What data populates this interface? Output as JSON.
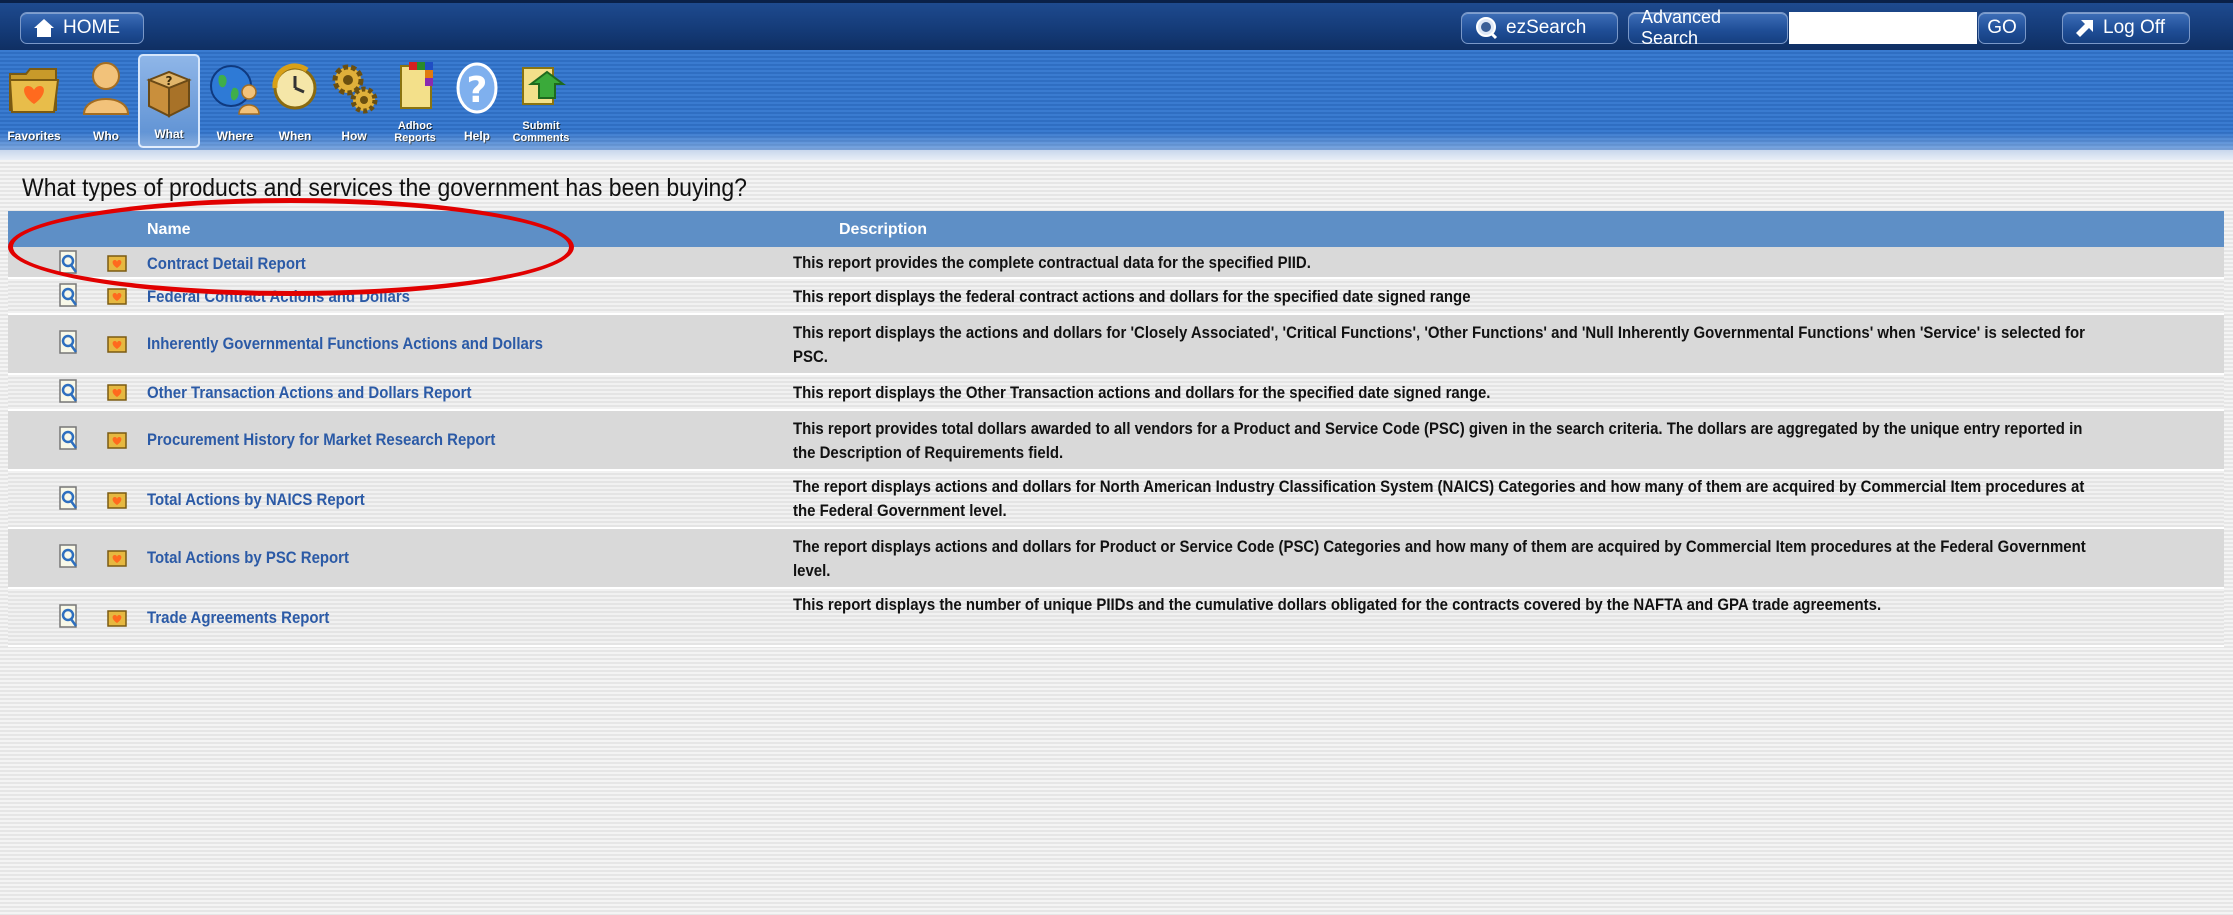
{
  "topbar": {
    "home_label": "HOME",
    "ezsearch_label": "ezSearch",
    "advanced_search_label": "Advanced Search",
    "search_value": "",
    "go_label": "GO",
    "logoff_label": "Log Off"
  },
  "toolbar": {
    "items": [
      {
        "label": "Favorites",
        "icon": "favorites-folder-icon"
      },
      {
        "label": "Who",
        "icon": "person-icon"
      },
      {
        "label": "What",
        "icon": "open-box-icon",
        "active": true
      },
      {
        "label": "Where",
        "icon": "globe-person-icon"
      },
      {
        "label": "When",
        "icon": "clock-icon"
      },
      {
        "label": "How",
        "icon": "gears-icon"
      },
      {
        "label": "Adhoc Reports",
        "icon": "adhoc-reports-icon"
      },
      {
        "label": "Help",
        "icon": "help-question-icon"
      },
      {
        "label": "Submit Comments",
        "icon": "submit-comments-icon"
      }
    ]
  },
  "page": {
    "title": "What types of products and services the government has been buying?"
  },
  "table": {
    "headers": {
      "name": "Name",
      "description": "Description"
    },
    "rows": [
      {
        "name": "Contract Detail Report",
        "description": "This report provides the complete contractual data for the specified PIID."
      },
      {
        "name": "Federal Contract Actions and Dollars",
        "description": "This report displays the federal contract actions and dollars for the specified date signed range"
      },
      {
        "name": "Inherently Governmental Functions Actions and Dollars",
        "description": "This report displays the actions and dollars for 'Closely Associated', 'Critical Functions', 'Other Functions' and 'Null Inherently Governmental Functions' when 'Service' is selected for PSC."
      },
      {
        "name": "Other Transaction Actions and Dollars Report",
        "description": "This report displays the Other Transaction actions and dollars for the specified date signed range."
      },
      {
        "name": "Procurement History for Market Research Report",
        "description": "This report provides total dollars awarded to all vendors for a Product and Service Code (PSC) given in the search criteria. The dollars are aggregated by the unique entry reported in the Description of Requirements field."
      },
      {
        "name": "Total Actions by NAICS Report",
        "description": "The report displays actions and dollars for North American Industry Classification System (NAICS) Categories and how many of them are acquired by Commercial Item procedures at the Federal Government level."
      },
      {
        "name": "Total Actions by PSC Report",
        "description": "The report displays actions and dollars for Product or Service Code (PSC) Categories and how many of them are acquired by Commercial Item procedures at the Federal Government level."
      },
      {
        "name": "Trade Agreements Report",
        "description": "This report displays the number of unique PIIDs and the cumulative dollars obligated for the contracts covered by the NAFTA and GPA trade agreements."
      }
    ]
  },
  "colors": {
    "topbar": "#143a76",
    "toolbar": "#3a7bd0",
    "table_header": "#5e8fc6",
    "link": "#2b5aa6",
    "highlight": "#e10000"
  }
}
